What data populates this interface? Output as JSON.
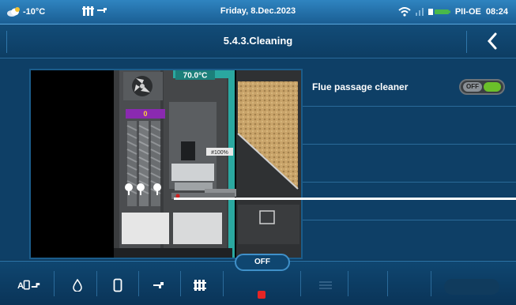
{
  "status": {
    "outdoor_temp": "-10°C",
    "date": "Friday, 8.Dec.2023",
    "device_id": "PII-OE",
    "time": "08:24"
  },
  "header": {
    "title": "5.4.3.Cleaning"
  },
  "boiler": {
    "temperature": "70.0°C",
    "fuel_level": "0",
    "tag": "#100%"
  },
  "settings": {
    "items": [
      {
        "label": "Flue passage cleaner",
        "toggle_state": "OFF",
        "toggle_left_text": "OFF"
      }
    ]
  },
  "bottom": {
    "mode_button": "OFF"
  },
  "colors": {
    "accent_blue": "#2f84c0",
    "toggle_green": "#6bbf2a",
    "stop_red": "#e52525",
    "teal_frame": "#2aa8a0",
    "fuel_purple": "#8a2ab0"
  }
}
